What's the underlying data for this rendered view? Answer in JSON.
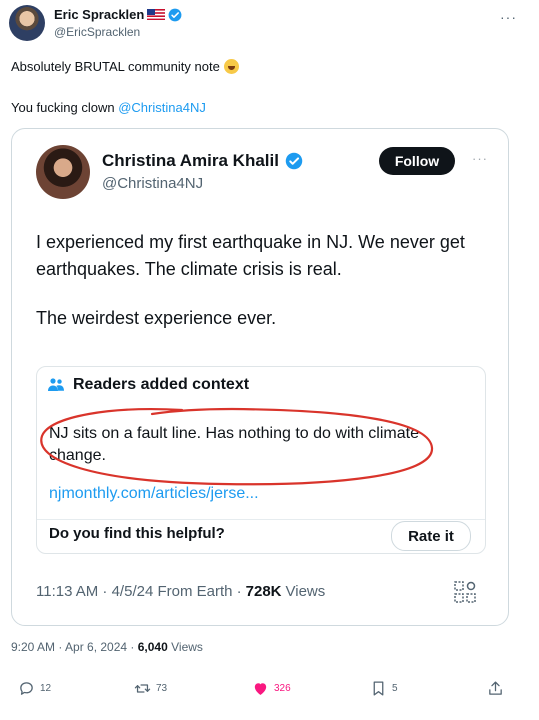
{
  "outer_tweet": {
    "author_name": "Eric Spracklen",
    "author_handle": "@EricSpracklen",
    "text_line_1": "Absolutely BRUTAL community note",
    "text_line_2_prefix": "You fucking clown",
    "text_line_2_mention": "@Christina4NJ",
    "timestamp": "9:20 AM · Apr 6, 2024 ·",
    "views_count": "6,040",
    "views_label": "Views",
    "more_glyph": "···"
  },
  "quoted_tweet": {
    "author_name": "Christina Amira Khalil",
    "author_handle": "@Christina4NJ",
    "follow_label": "Follow",
    "more_glyph": "···",
    "body_paragraph_1": "I experienced my first earthquake in NJ. We never get earthquakes. The climate crisis is real.",
    "body_paragraph_2": "The weirdest experience ever.",
    "community_note": {
      "title": "Readers added context",
      "text": "NJ sits on a fault line. Has nothing to do with climate change.",
      "link": "njmonthly.com/articles/jerse...",
      "helpful_prompt": "Do you find this helpful?",
      "rate_label": "Rate it"
    },
    "meta_time": "11:13 AM · 4/5/24 From Earth ·",
    "views_count": "728K",
    "views_label": "Views"
  },
  "actions": {
    "replies": "12",
    "reposts": "73",
    "likes": "326",
    "bookmarks": "5"
  },
  "colors": {
    "link_blue": "#1d9bf0",
    "like_pink": "#f91880",
    "annotation_red": "#d9342b",
    "verified_blue": "#1d9bf0"
  },
  "icons": [
    "verified-badge-icon",
    "us-flag-icon",
    "laughing-emoji-icon",
    "people-icon",
    "qr-code-icon",
    "reply-icon",
    "repost-icon",
    "heart-icon",
    "bookmark-icon",
    "share-icon"
  ]
}
